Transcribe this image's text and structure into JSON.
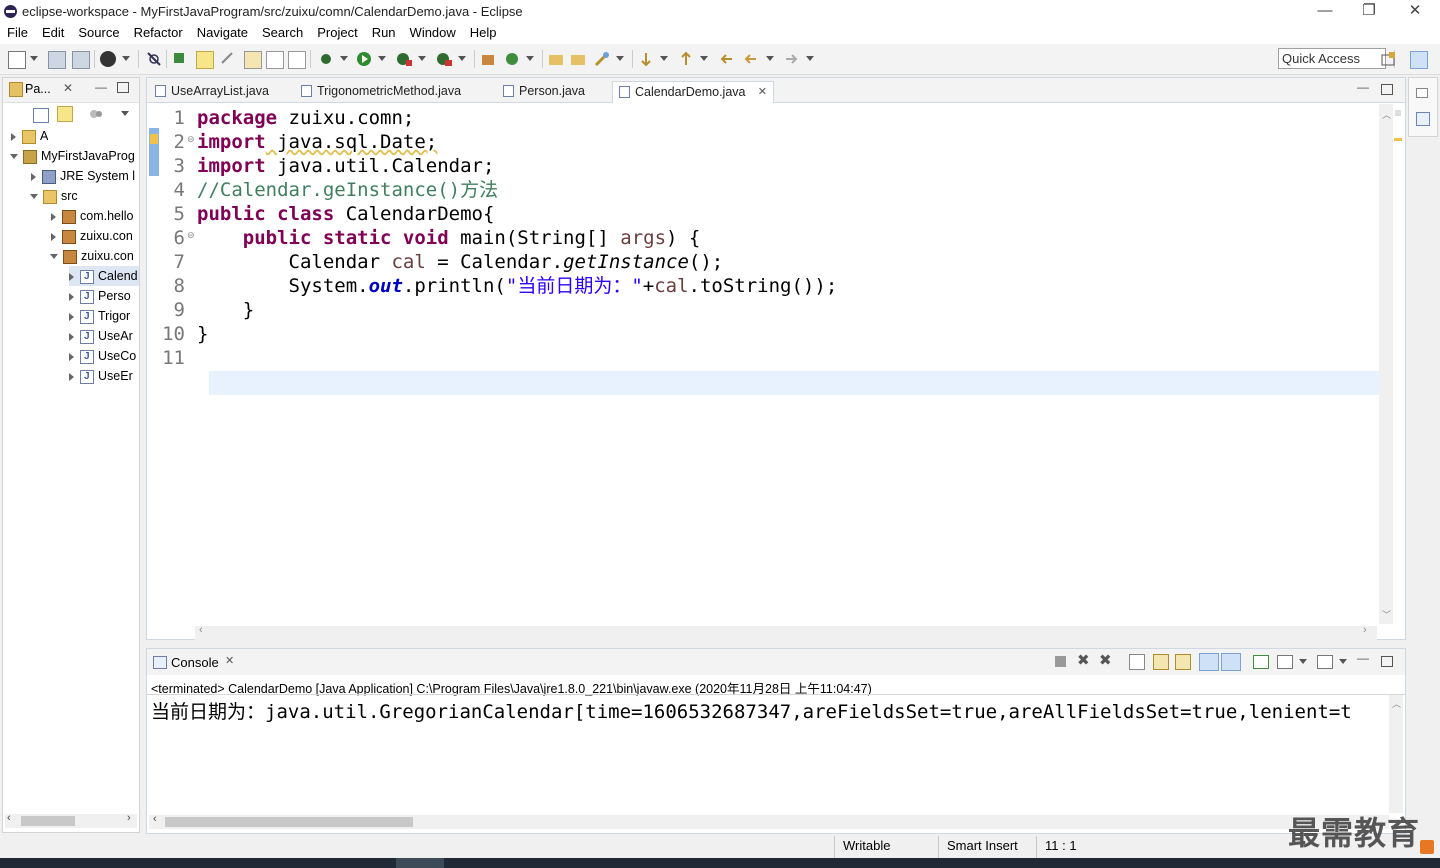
{
  "window": {
    "title": "eclipse-workspace - MyFirstJavaProgram/src/zuixu/comn/CalendarDemo.java - Eclipse",
    "minimize": "—",
    "restore": "❐",
    "close": "✕"
  },
  "menu": [
    "File",
    "Edit",
    "Source",
    "Refactor",
    "Navigate",
    "Search",
    "Project",
    "Run",
    "Window",
    "Help"
  ],
  "toolbar": {
    "quick_access": "Quick Access"
  },
  "package_explorer": {
    "title": "Pa...",
    "items": [
      {
        "label": "A",
        "icon": "folder-icon",
        "expanded": false
      },
      {
        "label": "MyFirstJavaProg",
        "icon": "project-icon",
        "expanded": true
      },
      {
        "label": "JRE System l",
        "icon": "library-icon",
        "expanded": false
      },
      {
        "label": "src",
        "icon": "source-folder-icon",
        "expanded": true
      },
      {
        "label": "com.hello",
        "icon": "package-icon",
        "expanded": false
      },
      {
        "label": "zuixu.con",
        "icon": "package-icon",
        "expanded": false
      },
      {
        "label": "zuixu.con",
        "icon": "package-icon",
        "expanded": true
      },
      {
        "label": "Calend",
        "icon": "java-file-icon",
        "expanded": false
      },
      {
        "label": "Perso",
        "icon": "java-file-icon",
        "expanded": false
      },
      {
        "label": "Trigor",
        "icon": "java-file-icon",
        "expanded": false
      },
      {
        "label": "UseAr",
        "icon": "java-file-icon",
        "expanded": false
      },
      {
        "label": "UseCo",
        "icon": "java-file-icon",
        "expanded": false
      },
      {
        "label": "UseEr",
        "icon": "java-file-icon",
        "expanded": false
      }
    ]
  },
  "editor": {
    "tabs": [
      {
        "label": "UseArrayList.java",
        "active": false
      },
      {
        "label": "TrigonometricMethod.java",
        "active": false
      },
      {
        "label": "Person.java",
        "active": false
      },
      {
        "label": "CalendarDemo.java",
        "active": true
      }
    ],
    "line_numbers": [
      "1",
      "2",
      "3",
      "4",
      "5",
      "6",
      "7",
      "8",
      "9",
      "10",
      "11"
    ],
    "code": {
      "l1_kw": "package",
      "l1_rest": " zuixu.comn;",
      "l2_kw": "import",
      "l2_rest": " java.sql.Date;",
      "l3_kw": "import",
      "l3_rest": " java.util.Calendar;",
      "l4_comment": "//Calendar.geInstance()方法",
      "l5_kw": "public class",
      "l5_rest": " CalendarDemo{",
      "l6_indent": "    ",
      "l6_kw": "public static void",
      "l6_rest": " main(String[] ",
      "l6_param": "args",
      "l6_end": ") {",
      "l7_a": "        Calendar ",
      "l7_var": "cal",
      "l7_b": " = Calendar.",
      "l7_method": "getInstance",
      "l7_c": "();",
      "l8_a": "        System.",
      "l8_field": "out",
      "l8_b": ".println(",
      "l8_str": "\"当前日期为：\"",
      "l8_c": "+",
      "l8_var": "cal",
      "l8_d": ".toString());",
      "l9": "    }",
      "l10": "}",
      "l11": ""
    }
  },
  "console": {
    "title": "Console",
    "terminated": "<terminated> CalendarDemo [Java Application] C:\\Program Files\\Java\\jre1.8.0_221\\bin\\javaw.exe (2020年11月28日 上午11:04:47)",
    "output": "当前日期为：java.util.GregorianCalendar[time=1606532687347,areFieldsSet=true,areAllFieldsSet=true,lenient=t"
  },
  "status": {
    "writable": "Writable",
    "insert_mode": "Smart Insert",
    "position": "11 : 1"
  },
  "watermark": "最需教育",
  "colors": {
    "keyword": "#7f0055",
    "comment": "#3f7f5f",
    "string": "#2a00ff",
    "field": "#0000c0",
    "current_line": "#e8f2fe"
  }
}
